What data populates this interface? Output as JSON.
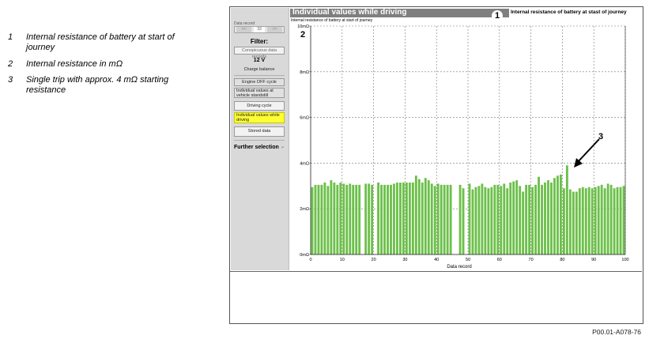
{
  "legend": [
    {
      "num": "1",
      "text": "Internal resistance of battery at start of journey"
    },
    {
      "num": "2",
      "text": "Internal resistance in mΩ"
    },
    {
      "num": "3",
      "text": "Single trip with approx. 4 mΩ starting resistance"
    }
  ],
  "panel": {
    "data_record_label": "Data record",
    "stepper_value": "33",
    "filter_label": "Filter:",
    "conspicuous_label": "Conspicuous data records",
    "voltage_label": "12 V",
    "charge_label": "Charge balance",
    "menu": [
      {
        "label": "Engine OFF cycle",
        "selected": false
      },
      {
        "label": "Individual values at vehicle standstill",
        "selected": false
      },
      {
        "label": "Driving cycle",
        "selected": false
      },
      {
        "label": "Individual values while driving",
        "selected": true
      },
      {
        "label": "Stored data",
        "selected": false
      }
    ],
    "further_selection": "Further selection"
  },
  "screen": {
    "title": "Individual values while driving",
    "tab_label": "Internal resistance of battery at stast of journey",
    "subtitle": "Internal resistance of battery at start of journey"
  },
  "callouts": {
    "one": "1",
    "two": "2",
    "three": "3"
  },
  "colors": {
    "bar": "#6cc04a",
    "selected": "#ffff33",
    "title_bar": "#7f7f7f"
  },
  "chart_data": {
    "type": "bar",
    "xlabel": "Data record",
    "ylabel": "",
    "xlim": [
      0,
      100
    ],
    "ylim": [
      0,
      10
    ],
    "x_ticks": [
      0,
      10,
      20,
      30,
      40,
      50,
      60,
      70,
      80,
      90,
      100
    ],
    "y_ticks": [
      0,
      2,
      4,
      6,
      8,
      10
    ],
    "y_tick_labels": [
      "0mΩ",
      "2mΩ",
      "4mΩ",
      "6mΩ",
      "8mΩ",
      "10mΩ"
    ],
    "grid": true,
    "x": [
      1,
      2,
      3,
      4,
      5,
      6,
      7,
      8,
      9,
      10,
      11,
      12,
      13,
      14,
      15,
      16,
      17,
      18,
      19,
      20,
      21,
      22,
      23,
      24,
      25,
      26,
      27,
      28,
      29,
      30,
      31,
      32,
      33,
      34,
      35,
      36,
      37,
      38,
      39,
      40,
      41,
      42,
      43,
      44,
      45,
      46,
      47,
      48,
      49,
      50,
      51,
      52,
      53,
      54,
      55,
      56,
      57,
      58,
      59,
      60,
      61,
      62,
      63,
      64,
      65,
      66,
      67,
      68,
      69,
      70,
      71,
      72,
      73,
      74,
      75,
      76,
      77,
      78,
      79,
      80,
      81,
      82,
      83,
      84,
      85,
      86,
      87,
      88,
      89,
      90,
      91,
      92,
      93,
      94,
      95,
      96,
      97,
      98,
      99,
      100
    ],
    "values": [
      2.95,
      3.05,
      3.05,
      3.05,
      3.15,
      3.0,
      3.25,
      3.15,
      3.05,
      3.15,
      3.1,
      3.05,
      3.1,
      3.05,
      3.05,
      3.05,
      0,
      3.1,
      3.1,
      3.05,
      0,
      3.15,
      3.05,
      3.05,
      3.05,
      3.05,
      3.1,
      3.15,
      3.15,
      3.15,
      3.15,
      3.15,
      3.15,
      3.45,
      3.3,
      3.15,
      3.35,
      3.25,
      3.1,
      3.0,
      3.1,
      3.05,
      3.05,
      3.05,
      3.05,
      0,
      0,
      3.05,
      2.9,
      0,
      3.1,
      2.85,
      2.95,
      3.0,
      3.1,
      2.95,
      2.9,
      2.95,
      3.05,
      3.05,
      3.0,
      3.1,
      2.9,
      3.15,
      3.2,
      3.25,
      3.0,
      2.75,
      3.05,
      3.05,
      2.95,
      3.05,
      3.4,
      3.05,
      3.15,
      3.25,
      3.15,
      3.35,
      3.45,
      3.5,
      2.9,
      3.9,
      2.85,
      2.75,
      2.75,
      2.9,
      2.95,
      2.9,
      2.95,
      2.9,
      2.95,
      3.0,
      3.05,
      2.9,
      3.1,
      3.05,
      2.9,
      2.95,
      2.95,
      3.0
    ]
  },
  "figure_code": "P00.01-A078-76"
}
